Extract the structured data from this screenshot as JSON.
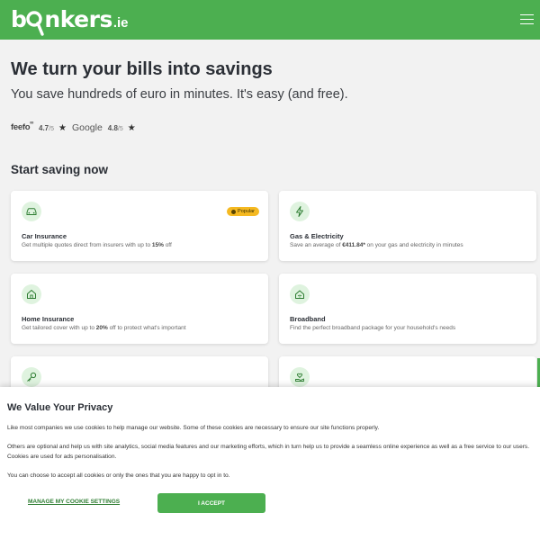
{
  "header": {
    "logo_brand": "bonkers",
    "logo_tld": ".ie",
    "brand_color": "#4caf50",
    "menu_icon": "hamburger-menu-icon"
  },
  "hero": {
    "title": "We turn your bills into savings",
    "subtitle": "You save hundreds of euro in minutes. It's easy (and free)."
  },
  "ratings": {
    "feefo_label": "feefo",
    "feefo_score": "4.7",
    "feefo_max": "/5",
    "google_label": "Google",
    "google_score": "4.8",
    "google_max": "/5",
    "star": "★"
  },
  "section_title": "Start saving now",
  "cards": [
    {
      "icon": "car-icon",
      "title": "Car Insurance",
      "desc_pre": "Get multiple quotes direct from insurers with up to ",
      "desc_bold": "15%",
      "desc_post": " off",
      "badge": "Popular"
    },
    {
      "icon": "lightning-bolt-icon",
      "title": "Gas & Electricity",
      "desc_pre": "Save an average of ",
      "desc_bold": "€411.84*",
      "desc_post": " on your gas and electricity in minutes"
    },
    {
      "icon": "house-icon",
      "title": "Home Insurance",
      "desc_pre": "Get tailored cover with up to ",
      "desc_bold": "20%",
      "desc_post": " off to protect what's important"
    },
    {
      "icon": "broadband-house-icon",
      "title": "Broadband",
      "desc_pre": "Find the perfect broadband package for your household's needs",
      "desc_bold": "",
      "desc_post": ""
    },
    {
      "icon": "key-icon"
    },
    {
      "icon": "hand-heart-icon"
    }
  ],
  "cookie_banner": {
    "title": "We Value Your Privacy",
    "paragraph_1": "Like most companies we use cookies to help manage our website. Some of these cookies are necessary to ensure our site functions properly.",
    "paragraph_2": "Others are optional and help us with site analytics, social media features and our marketing efforts, which in turn help us to provide a seamless online experience as well as a free service to our users. Cookies are used for ads personalisation.",
    "paragraph_3": "You can choose to accept all cookies or only the ones that you are happy to opt in to.",
    "manage_label": "MANAGE MY COOKIE SETTINGS",
    "accept_label": "I ACCEPT"
  }
}
